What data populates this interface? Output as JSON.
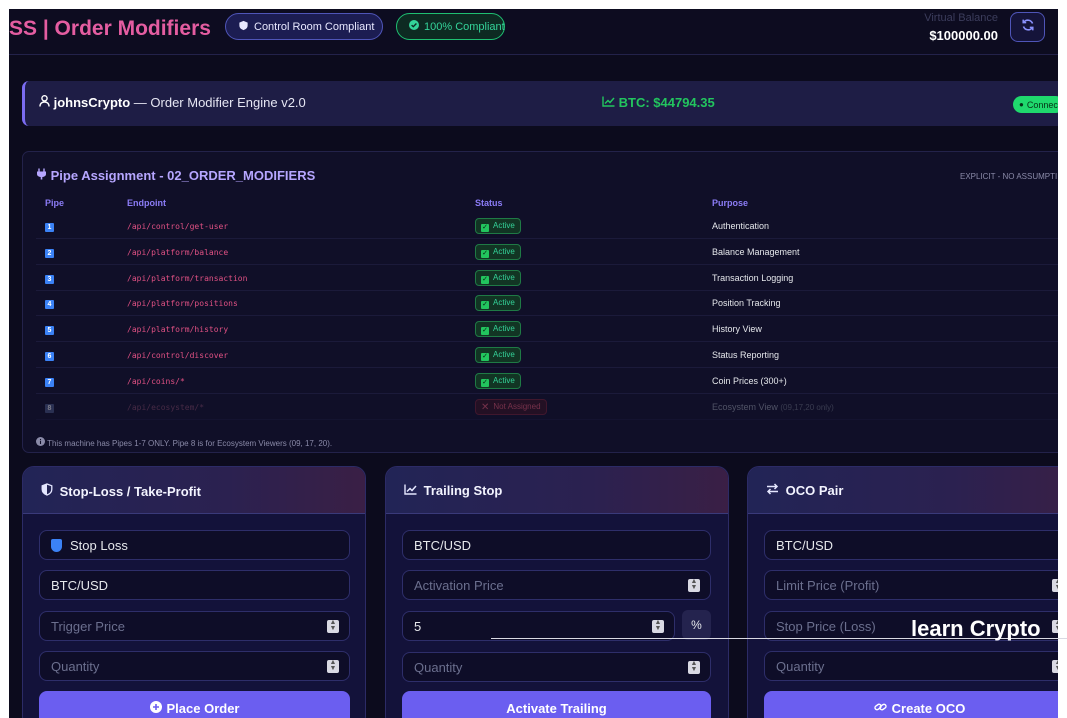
{
  "header": {
    "brand": "SS | Order Modifiers",
    "control_room_badge": "Control Room Compliant",
    "compliance_badge": "100% Compliant",
    "virtual_balance_label": "Virtual Balance",
    "virtual_balance_value": "$100000.00",
    "refresh_icon": "refresh-icon"
  },
  "banner": {
    "username": "johnsCrypto",
    "engine": " — Order Modifier Engine v2.0",
    "btc_price": "BTC: $44794.35",
    "connection": "Connec"
  },
  "pipes": {
    "title": "Pipe Assignment - 02_ORDER_MODIFIERS",
    "note": "EXPLICIT - NO ASSUMPTI",
    "columns": [
      "Pipe",
      "Endpoint",
      "Status",
      "Purpose"
    ],
    "rows": [
      {
        "pipe": "1",
        "endpoint": "/api/control/get-user",
        "status": "Active",
        "purpose": "Authentication"
      },
      {
        "pipe": "2",
        "endpoint": "/api/platform/balance",
        "status": "Active",
        "purpose": "Balance Management"
      },
      {
        "pipe": "3",
        "endpoint": "/api/platform/transaction",
        "status": "Active",
        "purpose": "Transaction Logging"
      },
      {
        "pipe": "4",
        "endpoint": "/api/platform/positions",
        "status": "Active",
        "purpose": "Position Tracking"
      },
      {
        "pipe": "5",
        "endpoint": "/api/platform/history",
        "status": "Active",
        "purpose": "History View"
      },
      {
        "pipe": "6",
        "endpoint": "/api/control/discover",
        "status": "Active",
        "purpose": "Status Reporting"
      },
      {
        "pipe": "7",
        "endpoint": "/api/coins/*",
        "status": "Active",
        "purpose": "Coin Prices (300+)"
      },
      {
        "pipe": "8",
        "endpoint": "/api/ecosystem/*",
        "status": "Not Assigned",
        "purpose": "Ecosystem View",
        "hint": "(09,17,20 only)"
      }
    ],
    "footer": "This machine has Pipes 1-7 ONLY. Pipe 8 is for Ecosystem Viewers (09, 17, 20)."
  },
  "cards": {
    "sltp": {
      "title": "Stop-Loss / Take-Profit",
      "order_type": "Stop Loss",
      "pair": "BTC/USD",
      "trigger_placeholder": "Trigger Price",
      "quantity_placeholder": "Quantity",
      "button": "Place Order"
    },
    "trailing": {
      "title": "Trailing Stop",
      "pair": "BTC/USD",
      "activation_placeholder": "Activation Price",
      "trail_value": "5",
      "unit": "%",
      "quantity_placeholder": "Quantity",
      "button": "Activate Trailing"
    },
    "oco": {
      "title": "OCO Pair",
      "pair": "BTC/USD",
      "limit_placeholder": "Limit Price (Profit)",
      "stop_placeholder": "Stop Price (Loss)",
      "quantity_placeholder": "Quantity",
      "button": "Create OCO"
    }
  },
  "watermark": "learn Crypto",
  "colors": {
    "background": "#0c0b1d",
    "brand": "#e45da1",
    "accent": "#6b5ef0",
    "active": "#34d399",
    "btc": "#22c55e",
    "inactive": "#f05a74"
  }
}
